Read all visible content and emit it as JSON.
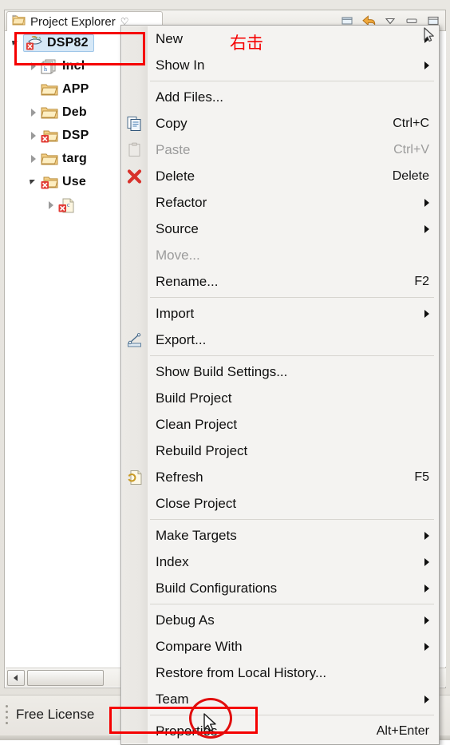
{
  "window": {
    "view_tab": {
      "label": "Project Explorer",
      "icon": "project-explorer-folder-icon",
      "close_glyph": "♡"
    },
    "toolbar_icons": [
      {
        "name": "collapse-all-icon"
      },
      {
        "name": "back-arrow-icon"
      },
      {
        "name": "view-menu-chevron-icon"
      },
      {
        "name": "minimize-icon"
      },
      {
        "name": "maximize-icon"
      }
    ]
  },
  "tree": {
    "items": [
      {
        "label": "DSP82",
        "icon": "ccs-project-error-icon",
        "twisty": "expanded",
        "selected": true,
        "indent": 0
      },
      {
        "label": "Incl",
        "icon": "includes-header-icon",
        "twisty": "collapsed",
        "selected": false,
        "indent": 1
      },
      {
        "label": "APP",
        "icon": "folder-icon",
        "twisty": "none",
        "selected": false,
        "indent": 1
      },
      {
        "label": "Deb",
        "icon": "folder-icon",
        "twisty": "collapsed",
        "selected": false,
        "indent": 1
      },
      {
        "label": "DSP",
        "icon": "folder-error-icon",
        "twisty": "collapsed",
        "selected": false,
        "indent": 1
      },
      {
        "label": "targ",
        "icon": "folder-icon",
        "twisty": "collapsed",
        "selected": false,
        "indent": 1
      },
      {
        "label": "Use",
        "icon": "folder-error-icon",
        "twisty": "expanded",
        "selected": false,
        "indent": 1
      },
      {
        "label": "",
        "icon": "c-source-error-icon",
        "twisty": "collapsed",
        "selected": false,
        "indent": 2
      }
    ]
  },
  "scrollbar": {
    "left_arrow": "scroll-left-arrow"
  },
  "statusbar": {
    "text": "Free License"
  },
  "context_menu": {
    "groups": [
      {
        "items": [
          {
            "label": "New",
            "accel": "",
            "submenu": true,
            "disabled": false,
            "icon": ""
          },
          {
            "label": "Show In",
            "accel": "",
            "submenu": true,
            "disabled": false,
            "icon": ""
          }
        ]
      },
      {
        "items": [
          {
            "label": "Add Files...",
            "accel": "",
            "submenu": false,
            "disabled": false,
            "icon": ""
          },
          {
            "label": "Copy",
            "accel": "Ctrl+C",
            "submenu": false,
            "disabled": false,
            "icon": "copy-icon"
          },
          {
            "label": "Paste",
            "accel": "Ctrl+V",
            "submenu": false,
            "disabled": true,
            "icon": "paste-icon"
          },
          {
            "label": "Delete",
            "accel": "Delete",
            "submenu": false,
            "disabled": false,
            "icon": "delete-x-icon"
          },
          {
            "label": "Refactor",
            "accel": "",
            "submenu": true,
            "disabled": false,
            "icon": ""
          },
          {
            "label": "Source",
            "accel": "",
            "submenu": true,
            "disabled": false,
            "icon": ""
          },
          {
            "label": "Move...",
            "accel": "",
            "submenu": false,
            "disabled": true,
            "icon": ""
          },
          {
            "label": "Rename...",
            "accel": "F2",
            "submenu": false,
            "disabled": false,
            "icon": ""
          }
        ]
      },
      {
        "items": [
          {
            "label": "Import",
            "accel": "",
            "submenu": true,
            "disabled": false,
            "icon": ""
          },
          {
            "label": "Export...",
            "accel": "",
            "submenu": false,
            "disabled": false,
            "icon": "export-icon"
          }
        ]
      },
      {
        "items": [
          {
            "label": "Show Build Settings...",
            "accel": "",
            "submenu": false,
            "disabled": false,
            "icon": ""
          },
          {
            "label": "Build Project",
            "accel": "",
            "submenu": false,
            "disabled": false,
            "icon": ""
          },
          {
            "label": "Clean Project",
            "accel": "",
            "submenu": false,
            "disabled": false,
            "icon": ""
          },
          {
            "label": "Rebuild Project",
            "accel": "",
            "submenu": false,
            "disabled": false,
            "icon": ""
          },
          {
            "label": "Refresh",
            "accel": "F5",
            "submenu": false,
            "disabled": false,
            "icon": "refresh-icon"
          },
          {
            "label": "Close Project",
            "accel": "",
            "submenu": false,
            "disabled": false,
            "icon": ""
          }
        ]
      },
      {
        "items": [
          {
            "label": "Make Targets",
            "accel": "",
            "submenu": true,
            "disabled": false,
            "icon": ""
          },
          {
            "label": "Index",
            "accel": "",
            "submenu": true,
            "disabled": false,
            "icon": ""
          },
          {
            "label": "Build Configurations",
            "accel": "",
            "submenu": true,
            "disabled": false,
            "icon": ""
          }
        ]
      },
      {
        "items": [
          {
            "label": "Debug As",
            "accel": "",
            "submenu": true,
            "disabled": false,
            "icon": ""
          },
          {
            "label": "Compare With",
            "accel": "",
            "submenu": true,
            "disabled": false,
            "icon": ""
          },
          {
            "label": "Restore from Local History...",
            "accel": "",
            "submenu": false,
            "disabled": false,
            "icon": ""
          },
          {
            "label": "Team",
            "accel": "",
            "submenu": true,
            "disabled": false,
            "icon": ""
          }
        ]
      },
      {
        "items": [
          {
            "label": "Properties",
            "accel": "Alt+Enter",
            "submenu": false,
            "disabled": false,
            "icon": ""
          }
        ]
      }
    ]
  },
  "annotations": {
    "text_note": "右击",
    "color": "#f50000",
    "highlight_project": "DSP82",
    "highlight_properties": "Properties"
  }
}
